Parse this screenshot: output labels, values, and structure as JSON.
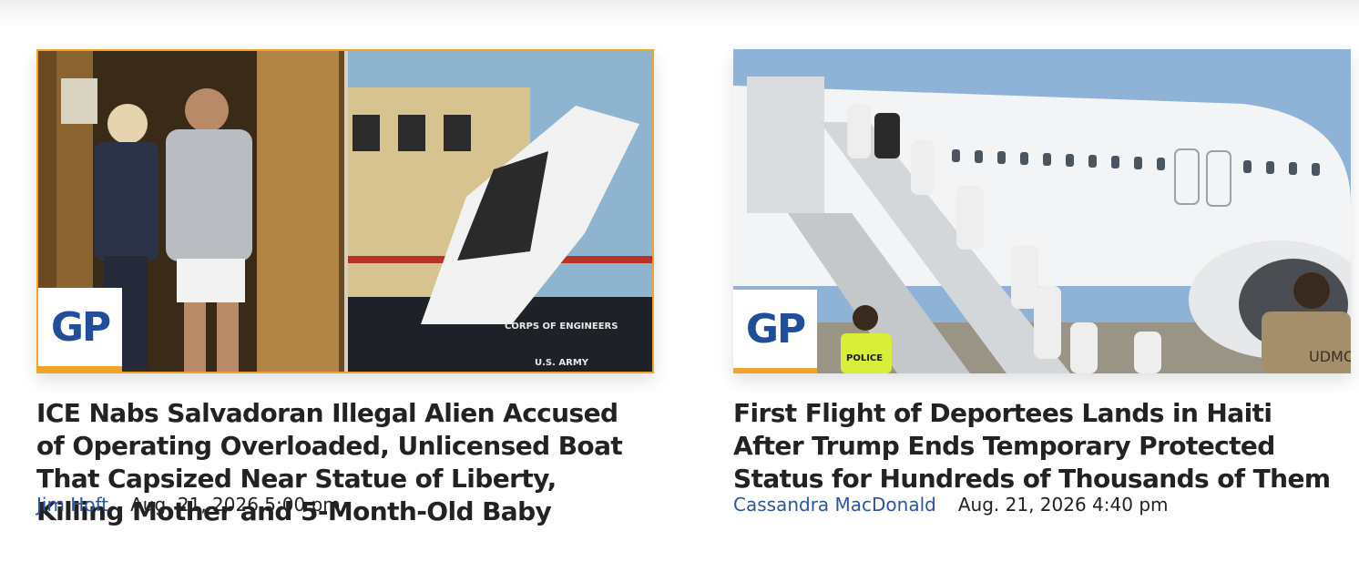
{
  "brand": {
    "badge_text": "GP",
    "accent_color": "#f0a52a",
    "badge_color": "#1f4e9b",
    "author_link_color": "#2a55a0"
  },
  "articles": [
    {
      "headline": "ICE Nabs Salvadoran Illegal Alien Accused of Operating Overloaded, Unlicensed Boat That Capsized Near Statue of Liberty, Killing Mother and 5-Month-Old Baby",
      "author": "Jim Hoft",
      "date": "Aug. 21, 2026 5:00 pm",
      "image_text": {
        "hull_text": "CORPS OF ENGINEERS",
        "hull_text_2": "U.S. ARMY"
      }
    },
    {
      "headline": "First Flight of Deportees Lands in Haiti After Trump Ends Temporary Protected Status for Hundreds of Thousands of Them",
      "author": "Cassandra MacDonald",
      "date": "Aug. 21, 2026 4:40 pm",
      "image_text": {
        "vest_text": "POLICE",
        "uniform_text": "UDMO"
      }
    }
  ]
}
